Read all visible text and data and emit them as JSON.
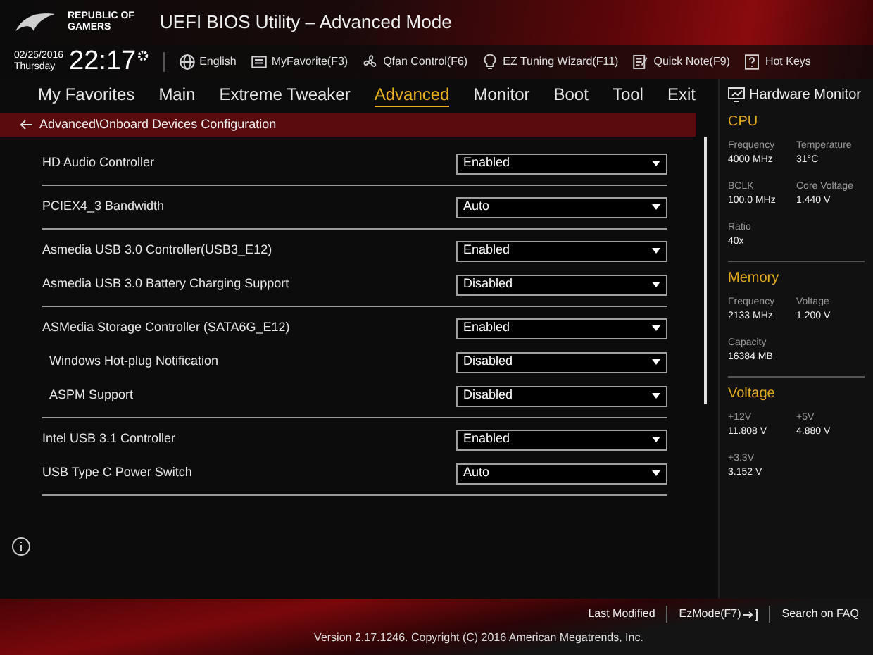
{
  "brand": {
    "line_1": "REPUBLIC OF",
    "line_2": "GAMERS"
  },
  "window": {
    "title": "UEFI BIOS Utility – Advanced Mode"
  },
  "clock": {
    "date": "02/25/2016",
    "weekday": "Thursday",
    "time": "22:17"
  },
  "toolbar": [
    {
      "kind": "globe",
      "label": "English"
    },
    {
      "kind": "favorite",
      "label": "MyFavorite(F3)"
    },
    {
      "kind": "fan",
      "label": "Qfan Control(F6)"
    },
    {
      "kind": "bulb",
      "label": "EZ Tuning Wizard(F11)"
    },
    {
      "kind": "note",
      "label": "Quick Note(F9)"
    },
    {
      "kind": "help",
      "label": "Hot Keys"
    }
  ],
  "tabs": [
    {
      "label": "My Favorites",
      "selected": false
    },
    {
      "label": "Main",
      "selected": false
    },
    {
      "label": "Extreme Tweaker",
      "selected": false
    },
    {
      "label": "Advanced",
      "selected": true
    },
    {
      "label": "Monitor",
      "selected": false
    },
    {
      "label": "Boot",
      "selected": false
    },
    {
      "label": "Tool",
      "selected": false
    },
    {
      "label": "Exit",
      "selected": false
    }
  ],
  "breadcrumb": "Advanced\\Onboard Devices Configuration",
  "groups": [
    {
      "items": [
        {
          "label": "HD Audio Controller",
          "value": "Enabled"
        }
      ]
    },
    {
      "items": [
        {
          "label": "PCIEX4_3 Bandwidth",
          "value": "Auto"
        }
      ]
    },
    {
      "items": [
        {
          "label": "Asmedia USB 3.0 Controller(USB3_E12)",
          "value": "Enabled"
        },
        {
          "label": "Asmedia USB 3.0 Battery Charging Support",
          "value": "Disabled"
        }
      ]
    },
    {
      "items": [
        {
          "label": "ASMedia Storage Controller (SATA6G_E12)",
          "value": "Enabled",
          "children": [
            {
              "label": "Windows Hot-plug Notification",
              "value": "Disabled"
            },
            {
              "label": "ASPM Support",
              "value": "Disabled"
            }
          ]
        }
      ]
    },
    {
      "items": [
        {
          "label": "Intel USB 3.1 Controller",
          "value": "Enabled"
        },
        {
          "label": "USB Type C Power Switch",
          "value": "Auto"
        }
      ]
    }
  ],
  "hardware_monitor": {
    "title": "Hardware Monitor",
    "sections": [
      {
        "title": "CPU",
        "readings": [
          {
            "label": "Frequency",
            "value": "4000 MHz"
          },
          {
            "label": "Temperature",
            "value": "31°C"
          },
          {
            "label": "BCLK",
            "value": "100.0 MHz"
          },
          {
            "label": "Core Voltage",
            "value": "1.440 V"
          },
          {
            "label": "Ratio",
            "value": "40x"
          }
        ]
      },
      {
        "title": "Memory",
        "readings": [
          {
            "label": "Frequency",
            "value": "2133 MHz"
          },
          {
            "label": "Voltage",
            "value": "1.200 V"
          },
          {
            "label": "Capacity",
            "value": "16384 MB"
          }
        ]
      },
      {
        "title": "Voltage",
        "readings": [
          {
            "label": "+12V",
            "value": "11.808 V"
          },
          {
            "label": "+5V",
            "value": "4.880 V"
          },
          {
            "label": "+3.3V",
            "value": "3.152 V"
          }
        ]
      }
    ]
  },
  "footer": {
    "actions": [
      {
        "kind": "text",
        "label": "Last Modified"
      },
      {
        "kind": "exit",
        "label": "EzMode(F7)"
      },
      {
        "kind": "text",
        "label": "Search on FAQ"
      }
    ],
    "version": "Version 2.17.1246. Copyright (C) 2016 American Megatrends, Inc."
  }
}
